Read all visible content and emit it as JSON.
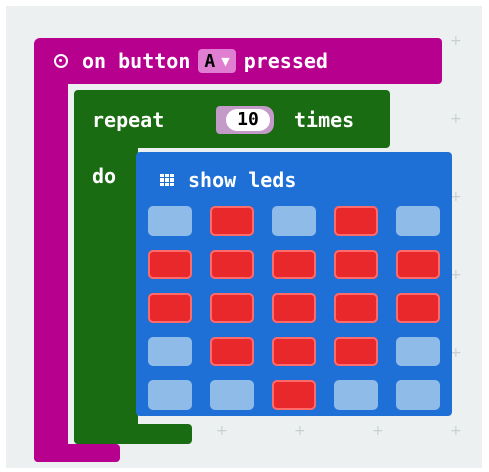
{
  "event_block": {
    "prefix": "on button",
    "button": "A",
    "suffix": "pressed",
    "color": "#b8008f"
  },
  "repeat_block": {
    "label": "repeat",
    "count": "10",
    "times_label": "times",
    "do_label": "do",
    "color": "#1a6c12"
  },
  "show_leds": {
    "label": "show leds",
    "color": "#1e70d6",
    "on_color": "#e9282b",
    "off_color": "#8fbbe8",
    "grid": [
      [
        0,
        1,
        0,
        1,
        0
      ],
      [
        1,
        1,
        1,
        1,
        1
      ],
      [
        1,
        1,
        1,
        1,
        1
      ],
      [
        0,
        1,
        1,
        1,
        0
      ],
      [
        0,
        0,
        1,
        0,
        0
      ]
    ]
  },
  "icons": {
    "event": "target-circle-icon",
    "dropdown": "caret-down-icon",
    "leds": "grid-icon"
  }
}
